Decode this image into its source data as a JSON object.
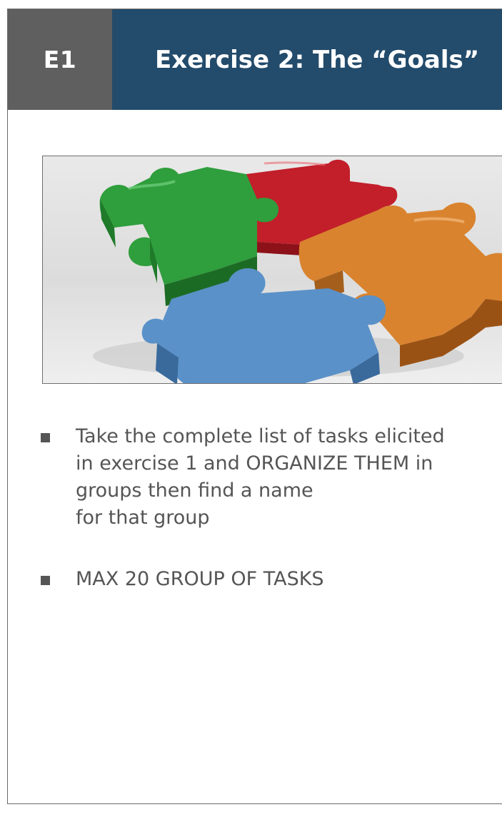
{
  "header": {
    "code": "E1",
    "title": "Exercise 2: The “Goals”"
  },
  "image": {
    "description_icon": "puzzle-pieces-illustration",
    "colors": {
      "green": "#2f9e3c",
      "red": "#c21f2a",
      "orange": "#d9832f",
      "blue": "#5a91c8"
    }
  },
  "bullets": [
    {
      "lines": [
        "Take the complete list of tasks elicited",
        "in exercise 1 and ORGANIZE THEM in",
        "groups then find a name",
        "for that group"
      ]
    },
    {
      "lines": [
        "MAX 20 GROUP OF TASKS"
      ]
    }
  ],
  "colors": {
    "code_box": "#5f5f5f",
    "title_bar": "#234b6b",
    "text": "#555555"
  }
}
